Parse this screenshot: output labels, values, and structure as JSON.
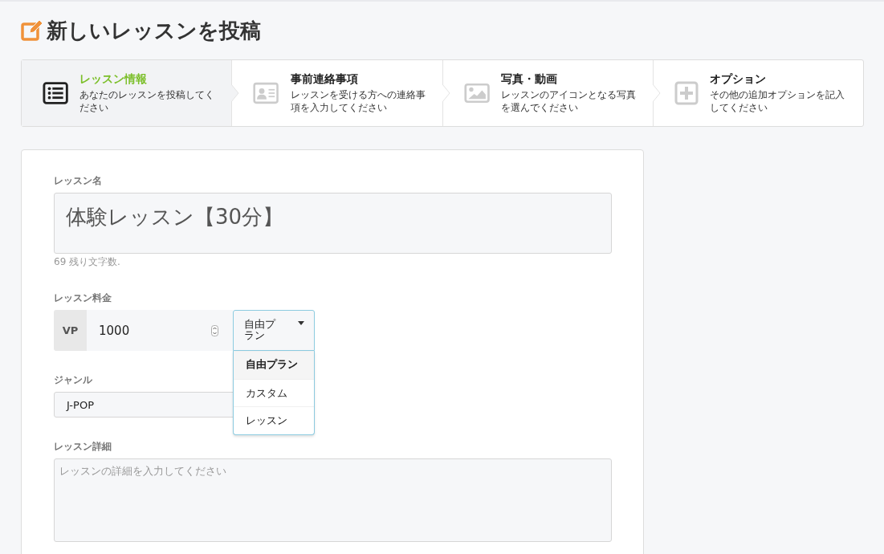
{
  "page_title": "新しいレッスンを投稿",
  "steps": [
    {
      "kind": "list",
      "title": "レッスン情報",
      "description": "あなたのレッスンを投稿してください",
      "selected": true
    },
    {
      "kind": "card",
      "title": "事前連絡事項",
      "description": "レッスンを受ける方への連絡事項を入力してください",
      "selected": false
    },
    {
      "kind": "image",
      "title": "写真・動画",
      "description": "レッスンのアイコンとなる写真を選んでください",
      "selected": false
    },
    {
      "kind": "plus",
      "title": "オプション",
      "description": "その他の追加オプションを記入してください",
      "selected": false
    }
  ],
  "lesson_name": {
    "label": "レッスン名",
    "value": "体験レッスン【30分】",
    "hint": "69 残り文字数."
  },
  "price": {
    "label": "レッスン料金",
    "prefix": "VP",
    "value": "1000",
    "plan": {
      "value": "自由プラン",
      "expanded": true,
      "options": [
        {
          "label": "自由プラン",
          "selected": true
        },
        {
          "label": "カスタム",
          "selected": false
        },
        {
          "label": "レッスン",
          "selected": false
        }
      ]
    }
  },
  "genre": {
    "label": "ジャンル",
    "value": "J-POP"
  },
  "details": {
    "label": "レッスン詳細",
    "placeholder": "レッスンの詳細を入力してください"
  }
}
